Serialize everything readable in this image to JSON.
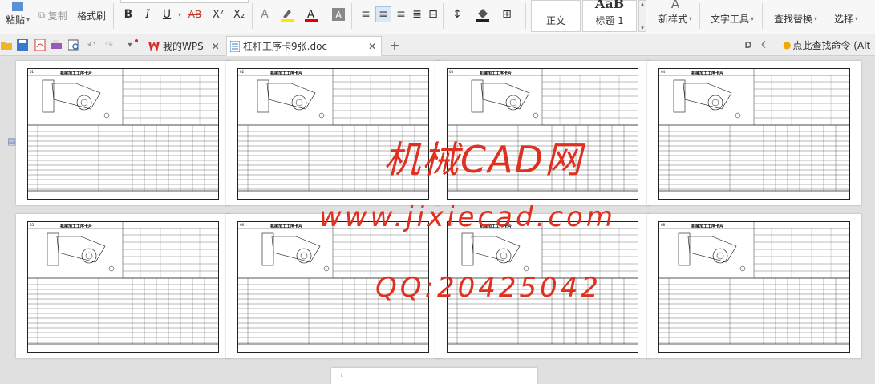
{
  "ribbon": {
    "paste_label": "粘贴",
    "copy_label": "复制",
    "format_painter_label": "格式刷",
    "bold": "B",
    "italic": "I",
    "underline": "U",
    "strike": "AB",
    "superscript": "X²",
    "subscript": "X₂",
    "style_normal": "正文",
    "style_heading1": "标题 1",
    "style_heading_preview": "AaB",
    "new_style_label": "新样式",
    "text_tools_label": "文字工具",
    "find_replace_label": "查找替换",
    "select_label": "选择"
  },
  "tabs": [
    {
      "label": "我的WPS"
    },
    {
      "label": "杠杆工序卡9张.doc"
    }
  ],
  "new_tab_symbol": "+",
  "find_command": "点此查找命令 (Alt-",
  "pages": [
    {
      "num": "01",
      "title": "机械加工工序卡片"
    },
    {
      "num": "02",
      "title": "机械加工工序卡片"
    },
    {
      "num": "03",
      "title": "机械加工工序卡片"
    },
    {
      "num": "04",
      "title": "机械加工工序卡片"
    },
    {
      "num": "05",
      "title": "机械加工工序卡片"
    },
    {
      "num": "06",
      "title": "机械加工工序卡片"
    },
    {
      "num": "07",
      "title": "机械加工工序卡片"
    },
    {
      "num": "08",
      "title": "机械加工工序卡片"
    }
  ],
  "watermark": {
    "line1": "机械CAD网",
    "line2": "www.jixiecad.com",
    "line3": "QQ:20425042",
    "color": "#e03020"
  }
}
